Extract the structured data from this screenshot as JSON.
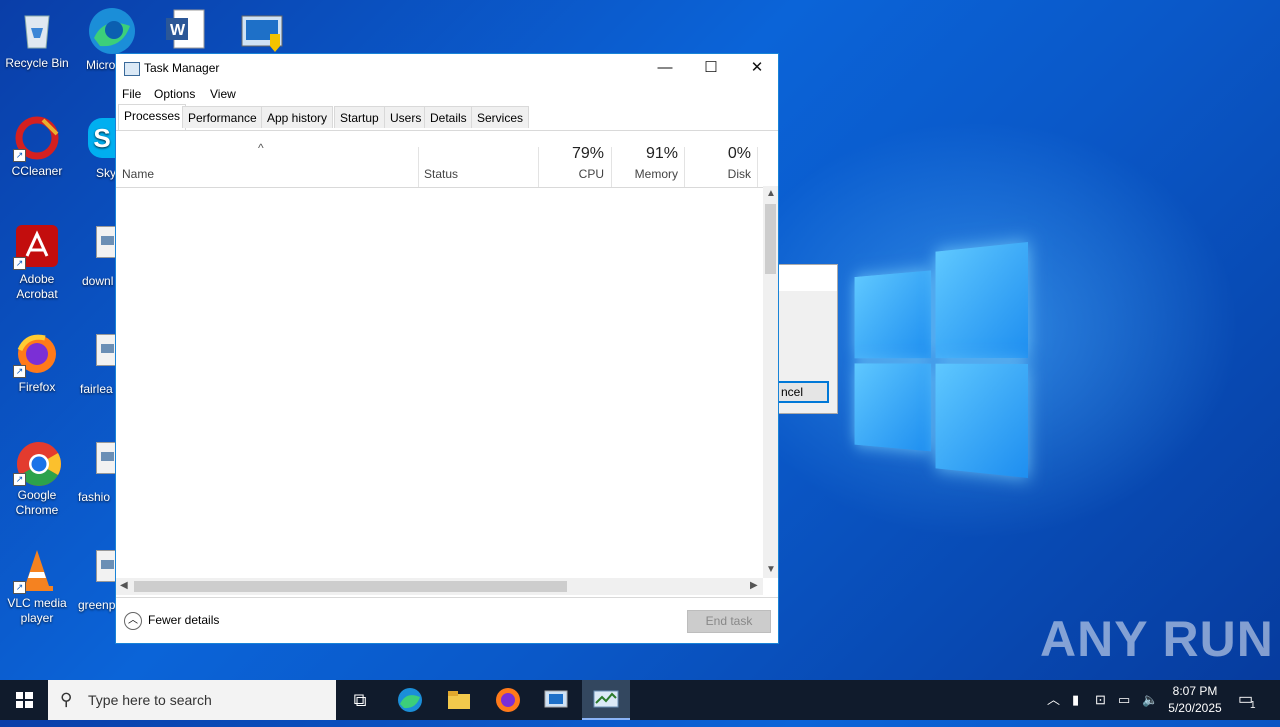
{
  "desktop": {
    "icons": [
      {
        "label": "Recycle Bin",
        "icon": "recycle-bin-icon"
      },
      {
        "label": "Micro Ed",
        "icon": "edge-icon"
      },
      {
        "label": "CCleaner",
        "icon": "ccleaner-icon"
      },
      {
        "label": "Sky",
        "icon": "skype-icon"
      },
      {
        "label": "Adobe Acrobat",
        "icon": "acrobat-icon"
      },
      {
        "label": "downl",
        "icon": "image-file-icon"
      },
      {
        "label": "Firefox",
        "icon": "firefox-icon"
      },
      {
        "label": "fairlea",
        "icon": "image-file-icon"
      },
      {
        "label": "Google Chrome",
        "icon": "chrome-icon"
      },
      {
        "label": "fashio",
        "icon": "image-file-icon"
      },
      {
        "label": "VLC media player",
        "icon": "vlc-icon"
      },
      {
        "label": "greenp",
        "icon": "image-file-icon"
      }
    ],
    "bg_dialog_button": "ncel",
    "watermark": "ANY RUN"
  },
  "task_manager": {
    "title": "Task Manager",
    "menu": [
      "File",
      "Options",
      "View"
    ],
    "tabs": [
      "Processes",
      "Performance",
      "App history",
      "Startup",
      "Users",
      "Details",
      "Services"
    ],
    "active_tab": "Processes",
    "columns": {
      "name": "Name",
      "status": "Status",
      "cpu_pct": "79%",
      "cpu": "CPU",
      "memory_pct": "91%",
      "memory": "Memory",
      "disk_pct": "0%",
      "disk": "Disk"
    },
    "fewer_details": "Fewer details",
    "end_task": "End task"
  },
  "taskbar": {
    "search_placeholder": "Type here to search",
    "time": "8:07 PM",
    "date": "5/20/2025",
    "notification_count": "1"
  }
}
